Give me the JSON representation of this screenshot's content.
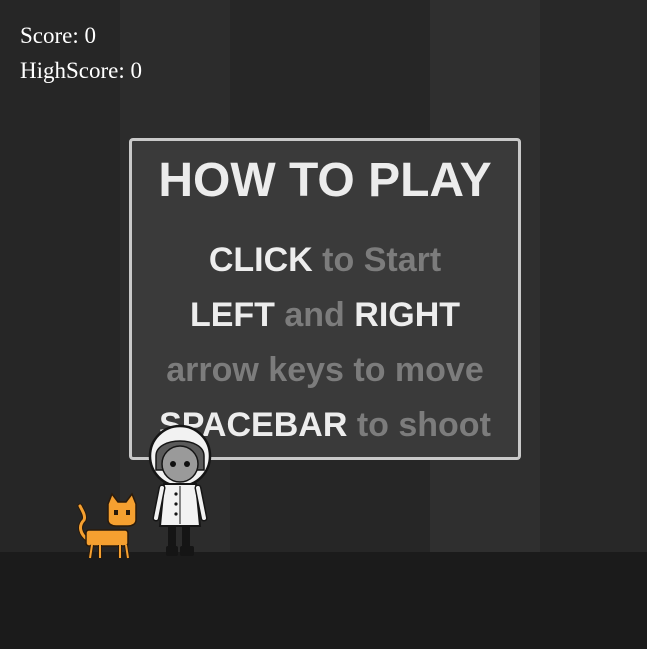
{
  "hud": {
    "score": "Score: 0",
    "high_score": "HighScore: 0"
  },
  "instructions": {
    "title": "HOW TO PLAY",
    "line1": {
      "key": "CLICK",
      "rest": "to Start"
    },
    "line2": {
      "key1": "LEFT",
      "and": "and",
      "key2": "RIGHT"
    },
    "line3": {
      "text": "arrow keys to move"
    },
    "line4": {
      "key": "SPACEBAR",
      "rest": "to shoot"
    }
  },
  "sprites": {
    "cat": "orange-cat",
    "player": "girl-in-white-hood"
  },
  "colors": {
    "background": "#2a2a2a",
    "ground": "#1b1b1b",
    "panel": "#3a3a3a",
    "panel_border": "#c9c9c9",
    "highlight_text": "#ededed",
    "dim_text": "#7c7c7c",
    "cat": "#f5a030"
  }
}
